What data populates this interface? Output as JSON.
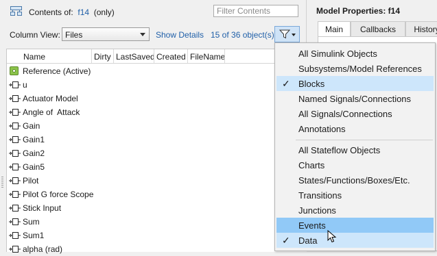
{
  "contents": {
    "prefix": "Contents of:",
    "model": "f14",
    "suffix": "(only)",
    "filter_placeholder": "Filter Contents"
  },
  "column_view": {
    "label": "Column View:",
    "value": "Files",
    "show_details": "Show Details",
    "count": "15 of 36 object(s)"
  },
  "table": {
    "columns": [
      "Name",
      "Dirty",
      "LastSaved",
      "Created",
      "FileName"
    ],
    "rows": [
      "Reference (Active)",
      "u",
      "Actuator Model",
      "Angle of  Attack",
      "Gain",
      "Gain1",
      "Gain2",
      "Gain5",
      "Pilot",
      "Pilot G force Scope",
      "Stick Input",
      "Sum",
      "Sum1",
      "alpha (rad)"
    ]
  },
  "model_properties": {
    "title": "Model Properties: f14",
    "tabs": [
      "Main",
      "Callbacks",
      "History"
    ]
  },
  "filter_menu": {
    "group1": [
      {
        "label": "All Simulink Objects",
        "checked": false
      },
      {
        "label": "Subsystems/Model References",
        "checked": false
      },
      {
        "label": "Blocks",
        "checked": true
      },
      {
        "label": "Named Signals/Connections",
        "checked": false
      },
      {
        "label": "All Signals/Connections",
        "checked": false
      },
      {
        "label": "Annotations",
        "checked": false
      }
    ],
    "group2": [
      {
        "label": "All Stateflow Objects",
        "checked": false
      },
      {
        "label": "Charts",
        "checked": false
      },
      {
        "label": "States/Functions/Boxes/Etc.",
        "checked": false
      },
      {
        "label": "Transitions",
        "checked": false
      },
      {
        "label": "Junctions",
        "checked": false
      },
      {
        "label": "Events",
        "checked": false,
        "highlighted": true
      },
      {
        "label": "Data",
        "checked": true
      }
    ],
    "check_glyph": "✓"
  },
  "colors": {
    "link": "#1f5fa8",
    "menu_highlight": "#91c9f7",
    "menu_checked": "#cde6fb"
  }
}
